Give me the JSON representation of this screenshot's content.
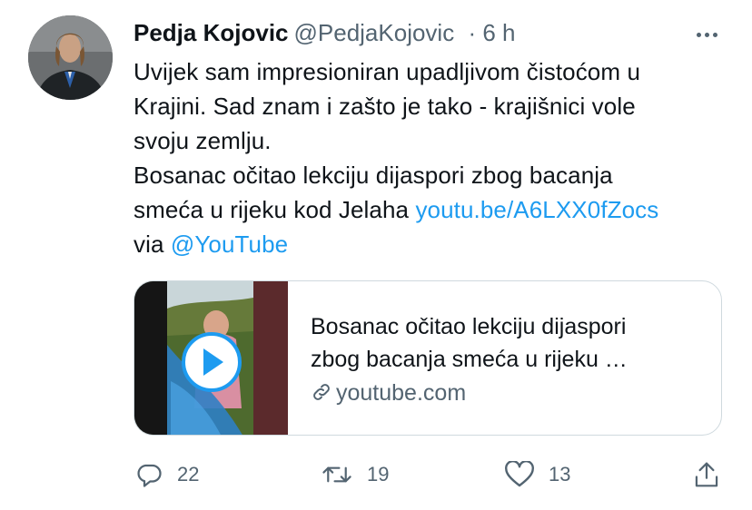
{
  "tweet": {
    "author_name": "Pedja Kojovic",
    "handle": "@PedjaKojovic",
    "time": "· 6 h",
    "text_lines": [
      "Uvijek sam impresioniran upadljivom čistoćom u",
      "Krajini. Sad znam i zašto je tako - krajišnici vole",
      "svoju zemlju.",
      "Bosanac očitao lekciju dijaspori zbog bacanja",
      "smeća u rijeku kod Jelaha"
    ],
    "link": "youtu.be/A6LXX0fZocs",
    "via_text": "via",
    "mention": "@YouTube"
  },
  "card": {
    "title_line1": "Bosanac očitao lekciju dijaspori",
    "title_line2": "zbog bacanja smeća u rijeku …",
    "domain": "youtube.com"
  },
  "actions": {
    "replies": "22",
    "retweets": "19",
    "likes": "13"
  },
  "icons": {
    "more": "more-dots-icon",
    "reply": "reply-icon",
    "retweet": "retweet-icon",
    "like": "heart-icon",
    "share": "share-icon",
    "link": "link-icon",
    "play": "play-icon"
  },
  "colors": {
    "link": "#1d9bf0",
    "secondary_text": "#536471",
    "primary_text": "#0f1419",
    "border": "#cfd9de"
  }
}
